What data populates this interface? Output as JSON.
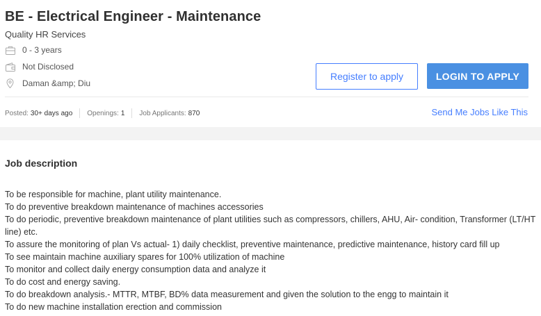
{
  "job": {
    "title": "BE - Electrical Engineer - Maintenance",
    "company": "Quality HR Services",
    "experience": "0 - 3 years",
    "salary": "Not Disclosed",
    "location": "Daman &amp; Diu"
  },
  "actions": {
    "register_label": "Register to apply",
    "login_label": "LOGIN TO APPLY",
    "send_jobs_label": "Send Me Jobs Like This"
  },
  "stats": {
    "posted_label": "Posted:",
    "posted_value": "30+ days ago",
    "openings_label": "Openings:",
    "openings_value": "1",
    "applicants_label": "Job Applicants:",
    "applicants_value": "870"
  },
  "description": {
    "heading": "Job description",
    "lines": [
      "To be responsible for machine, plant utility maintenance.",
      "To do preventive breakdown maintenance of machines accessories",
      "To do periodic, preventive breakdown maintenance of plant utilities such as compressors, chillers, AHU, Air- condition, Transformer (LT/HT line) etc.",
      "To assure the monitoring of plan Vs actual- 1) daily checklist, preventive maintenance, predictive maintenance, history card fill up",
      "To see maintain machine auxiliary spares for 100% utilization of machine",
      "To monitor and collect daily energy consumption data and analyze it",
      "To do cost and energy saving.",
      "To do breakdown analysis.- MTTR, MTBF, BD% data measurement and given the solution to the engg to maintain it",
      "To do new machine installation erection and commission"
    ]
  },
  "icons": {
    "experience": "briefcase-icon",
    "salary": "wallet-icon",
    "location": "location-pin-icon"
  },
  "colors": {
    "accent": "#457eff",
    "login_button": "#4a90e2",
    "page_background": "#f3f3f3"
  }
}
